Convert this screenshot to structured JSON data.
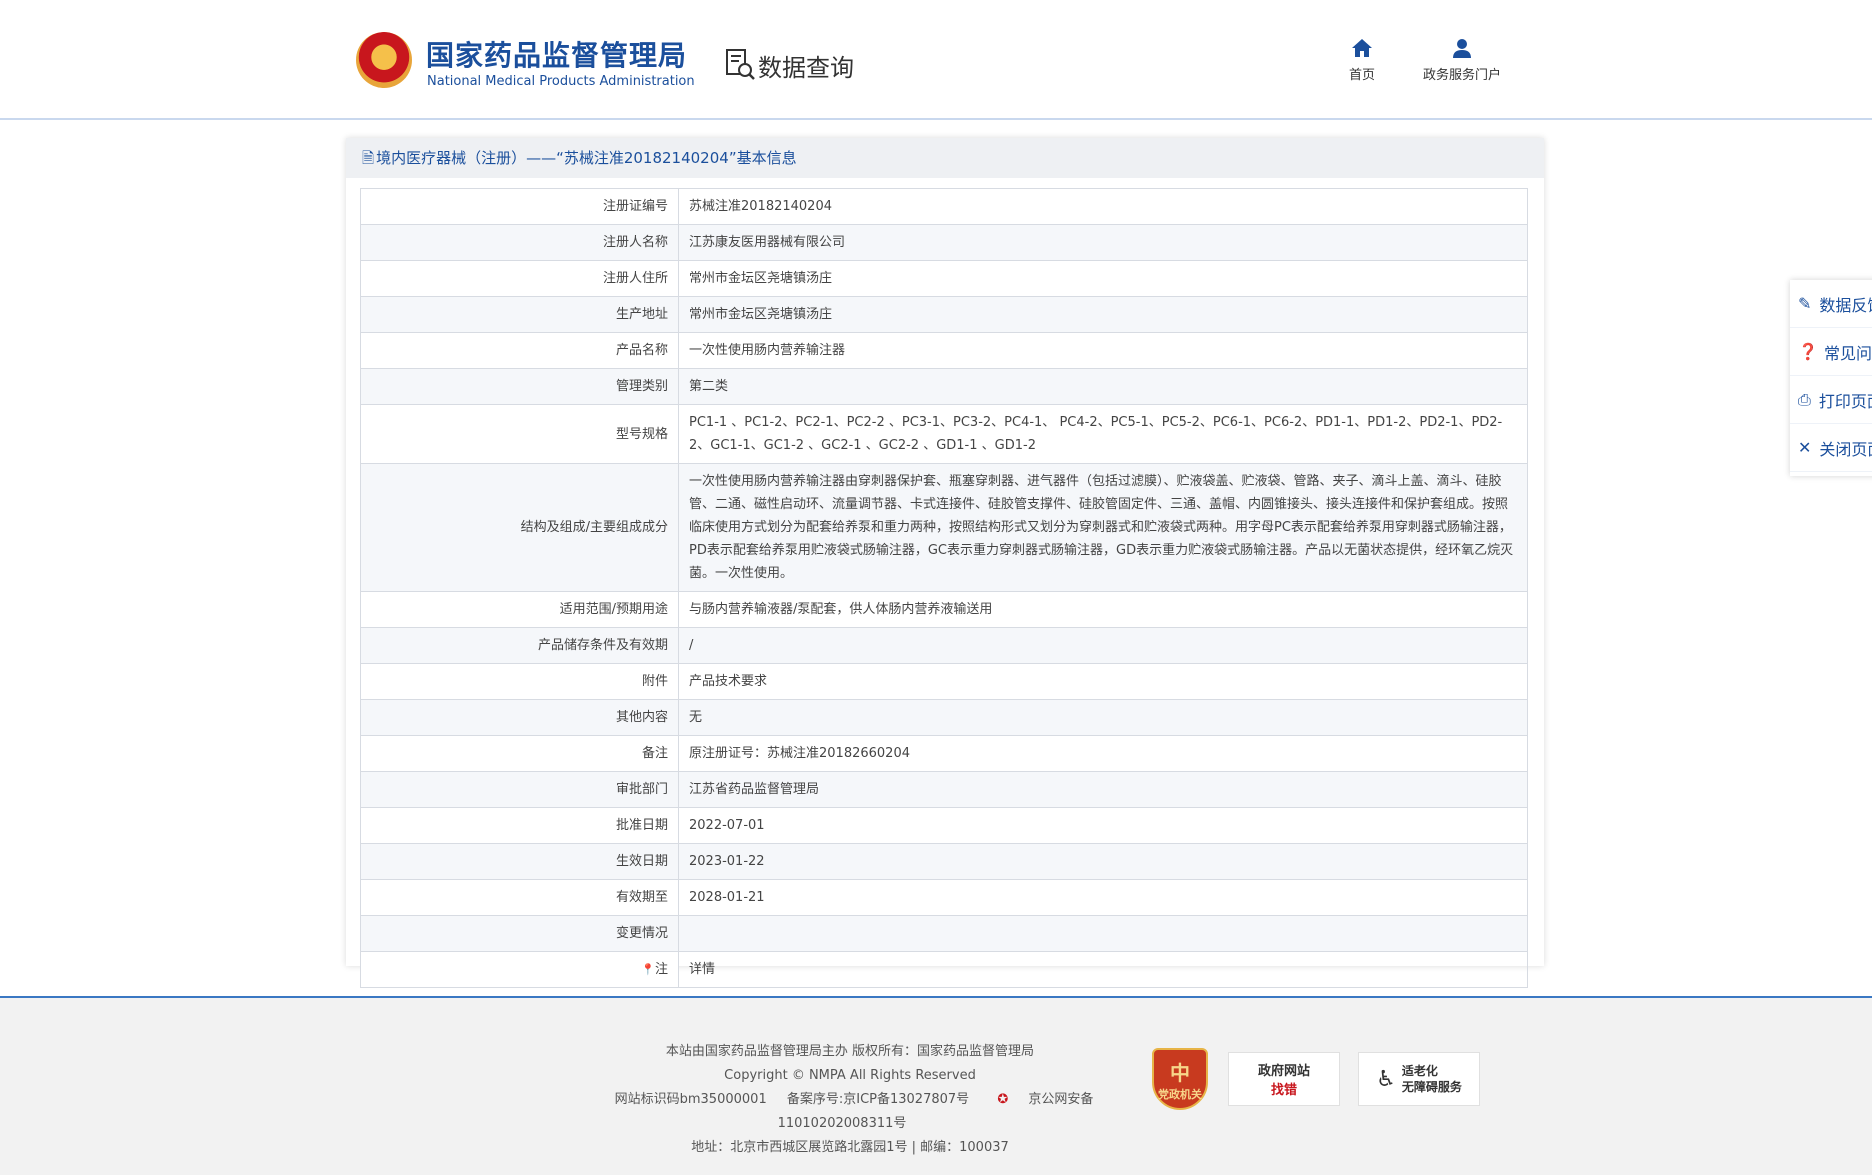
{
  "header": {
    "site_cn": "国家药品监督管理局",
    "site_en": "National Medical Products Administration",
    "section": "数据查询",
    "nav": {
      "home": "首页",
      "portal": "政务服务门户"
    }
  },
  "side": {
    "feedback": "数据反馈",
    "faq": "常见问题",
    "print": "打印页面",
    "close": "关闭页面"
  },
  "card": {
    "title": "境内医疗器械（注册）——“苏械注准20182140204”基本信息"
  },
  "rows": [
    {
      "label": "注册证编号",
      "value": "苏械注准20182140204"
    },
    {
      "label": "注册人名称",
      "value": "江苏康友医用器械有限公司"
    },
    {
      "label": "注册人住所",
      "value": "常州市金坛区尧塘镇汤庄"
    },
    {
      "label": "生产地址",
      "value": "常州市金坛区尧塘镇汤庄"
    },
    {
      "label": "产品名称",
      "value": "一次性使用肠内营养输注器"
    },
    {
      "label": "管理类别",
      "value": "第二类"
    },
    {
      "label": "型号规格",
      "value": "PC1-1 、PC1-2、PC2-1、PC2-2 、PC3-1、PC3-2、PC4-1、 PC4-2、PC5-1、PC5-2、PC6-1、PC6-2、PD1-1、PD1-2、PD2-1、PD2-2、GC1-1、GC1-2 、GC2-1 、GC2-2 、GD1-1 、GD1-2"
    },
    {
      "label": "结构及组成/主要组成成分",
      "value": "一次性使用肠内营养输注器由穿刺器保护套、瓶塞穿刺器、进气器件（包括过滤膜）、贮液袋盖、贮液袋、管路、夹子、滴斗上盖、滴斗、硅胶管、二通、磁性启动环、流量调节器、卡式连接件、硅胶管支撑件、硅胶管固定件、三通、盖帽、内圆锥接头、接头连接件和保护套组成。按照临床使用方式划分为配套给养泵和重力两种，按照结构形式又划分为穿刺器式和贮液袋式两种。用字母PC表示配套给养泵用穿刺器式肠输注器，PD表示配套给养泵用贮液袋式肠输注器，GC表示重力穿刺器式肠输注器，GD表示重力贮液袋式肠输注器。产品以无菌状态提供，经环氧乙烷灭菌。一次性使用。"
    },
    {
      "label": "适用范围/预期用途",
      "value": "与肠内营养输液器/泵配套，供人体肠内营养液输送用"
    },
    {
      "label": "产品储存条件及有效期",
      "value": "/"
    },
    {
      "label": "附件",
      "value": "产品技术要求"
    },
    {
      "label": "其他内容",
      "value": "无"
    },
    {
      "label": "备注",
      "value": "原注册证号：苏械注准20182660204"
    },
    {
      "label": "审批部门",
      "value": "江苏省药品监督管理局"
    },
    {
      "label": "批准日期",
      "value": "2022-07-01"
    },
    {
      "label": "生效日期",
      "value": "2023-01-22"
    },
    {
      "label": "有效期至",
      "value": "2028-01-21"
    },
    {
      "label": "变更情况",
      "value": ""
    },
    {
      "label": "注",
      "value": "详情"
    }
  ],
  "footer": {
    "line1": "本站由国家药品监督管理局主办 版权所有：国家药品监督管理局",
    "line2": "Copyright © NMPA All Rights Reserved",
    "site_id": "网站标识码bm35000001",
    "icp": "备案序号:京ICP备13027807号",
    "police": "京公网安备11010202008311号",
    "address": "地址：北京市西城区展览路北露园1号 | 邮编：100037",
    "badge_party": "党政机关",
    "badge_gov_top": "政府网站",
    "badge_gov_bot": "找错",
    "badge_access_1": "适老化",
    "badge_access_2": "无障碍服务"
  }
}
